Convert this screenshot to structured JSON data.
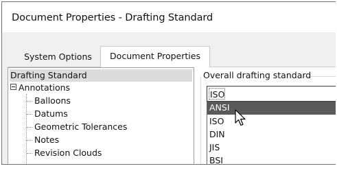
{
  "window": {
    "title": "Document Properties - Drafting Standard"
  },
  "tabs": [
    {
      "label": "System Options",
      "active": false
    },
    {
      "label": "Document Properties",
      "active": true
    }
  ],
  "tree": {
    "root": "Drafting Standard",
    "group": "Annotations",
    "items": [
      "Balloons",
      "Datums",
      "Geometric Tolerances",
      "Notes",
      "Revision Clouds"
    ]
  },
  "standard": {
    "label": "Overall drafting standard",
    "current_value": "ISO",
    "options": [
      "ANSI",
      "ISO",
      "DIN",
      "JIS",
      "BSI"
    ],
    "highlighted": "ANSI"
  },
  "icons": {
    "expander": "minus-box-icon",
    "cursor": "arrow-cursor-icon"
  },
  "colors": {
    "highlight": "#5a5a5a",
    "tree_selection": "#dcdcdc",
    "background": "#f0f0f0"
  }
}
